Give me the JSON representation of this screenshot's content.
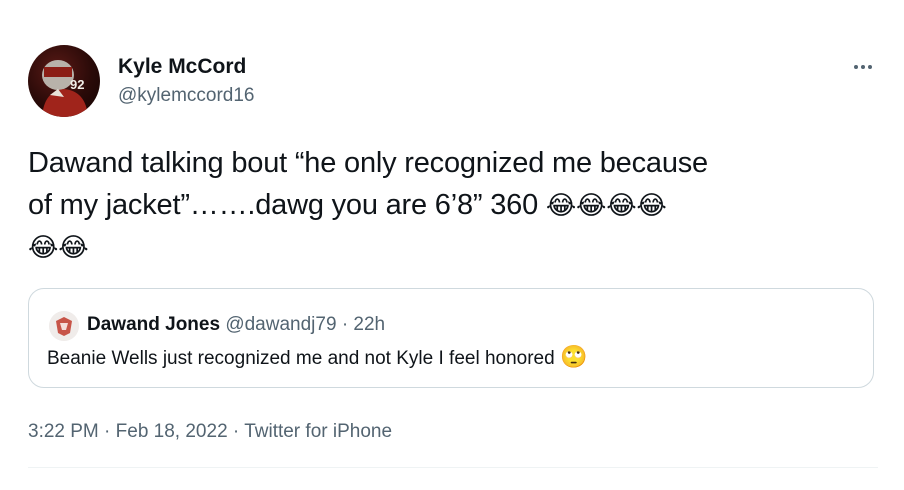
{
  "author": {
    "name": "Kyle McCord",
    "handle": "@kylemccord16",
    "jersey_number": "92"
  },
  "more_icon": "more-horizontal-icon",
  "tweet": {
    "line1": "Dawand talking bout “he only recognized me because",
    "line2": "of my jacket”…….dawg you are 6’8” 360 ",
    "trailing_emoji_count": 6,
    "emoji": "😂",
    "emoji_icon": "face-with-tears-of-joy-icon"
  },
  "quote": {
    "name": "Dawand Jones",
    "handle": "@dawandj79",
    "separator": "·",
    "time": "22h",
    "text": "Beanie Wells just recognized me and not Kyle I feel honored ",
    "emoji": "🙄",
    "emoji_icon": "face-with-rolling-eyes-icon"
  },
  "footer": {
    "time": "3:22 PM",
    "dot1": "·",
    "date": "Feb 18, 2022",
    "dot2": "·",
    "source": "Twitter for iPhone"
  },
  "colors": {
    "text_primary": "#0f1419",
    "text_secondary": "#536471",
    "border": "#cfd9de"
  }
}
